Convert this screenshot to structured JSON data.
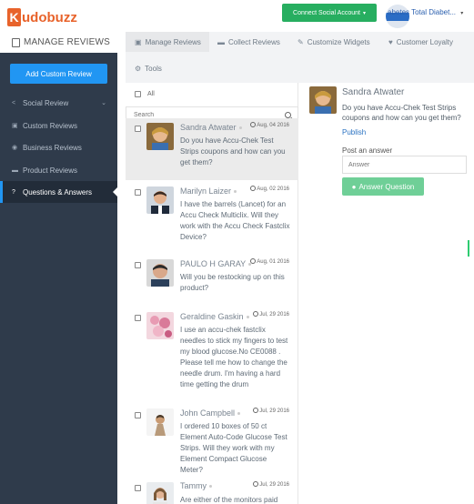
{
  "brand": {
    "logo_letter": "K",
    "logo_text": "udobuzz",
    "accent": "#e8632b"
  },
  "topbar": {
    "connect_label": "Connect Social Account",
    "connect_caret": "▾",
    "store_name": "abetes Total Diabet...",
    "store_caret": "▾"
  },
  "sidebar": {
    "header": "MANAGE REVIEWS",
    "add_button": "Add Custom Review",
    "items": [
      {
        "icon": "share-icon",
        "glyph": "<",
        "label": "Social Review",
        "chevron": "⌄"
      },
      {
        "icon": "copy-icon",
        "glyph": "▣",
        "label": "Custom Reviews"
      },
      {
        "icon": "globe-icon",
        "glyph": "◉",
        "label": "Business Reviews"
      },
      {
        "icon": "cart-icon",
        "glyph": "▬",
        "label": "Product Reviews"
      },
      {
        "icon": "question-icon",
        "glyph": "?",
        "label": "Questions & Answers"
      }
    ]
  },
  "tabs": [
    {
      "icon": "copy-icon",
      "glyph": "▣",
      "label": "Manage Reviews"
    },
    {
      "icon": "card-icon",
      "glyph": "▬",
      "label": "Collect Reviews"
    },
    {
      "icon": "edit-icon",
      "glyph": "✎",
      "label": "Customize Widgets"
    },
    {
      "icon": "heart-icon",
      "glyph": "♥",
      "label": "Customer Loyalty"
    },
    {
      "icon": "gears-icon",
      "glyph": "⚙",
      "label": "Tools"
    }
  ],
  "list": {
    "select_all": "All",
    "search_placeholder": "Search",
    "items": [
      {
        "name": "Sandra Atwater",
        "date": "Aug, 04 2016",
        "text": "Do you have Accu-Chek Test Strips coupons and how can you get them?"
      },
      {
        "name": "Marilyn Laizer",
        "date": "Aug, 02 2016",
        "text": "I have the barrels (Lancet) for an Accu Check Multiclix. Will they work with the Accu Check Fastclix Device?"
      },
      {
        "name": "PAULO H GARAY",
        "date": "Aug, 01 2016",
        "text": "Will you be restocking up on this product?"
      },
      {
        "name": "Geraldine Gaskin",
        "date": "Jul, 29 2016",
        "text": "I use an accu-chek fastclix needles to stick my fingers to test my blood glucose.No CE0088 . Please tell me how to change the needle drum. I'm having a hard time getting the drum"
      },
      {
        "name": "John Campbell",
        "date": "Jul, 29 2016",
        "text": "I ordered 10 boxes of 50 ct Element Auto-Code Glucose Test Strips. Will they work with my Element Compact Glucose Meter?"
      },
      {
        "name": "Tammy",
        "date": "Jul, 29 2016",
        "text": "Are either of the monitors paid"
      }
    ]
  },
  "detail": {
    "name": "Sandra Atwater",
    "question": "Do you have Accu-Chek Test Strips coupons and how can you get them?",
    "publish": "Publish",
    "post_label": "Post an answer",
    "answer_placeholder": "Answer",
    "answer_button": "Answer Question"
  },
  "colors": {
    "sidebar_bg": "#2f3b4b",
    "primary": "#2196f3",
    "success": "#27ae60",
    "answer_btn": "#6fcf97"
  }
}
